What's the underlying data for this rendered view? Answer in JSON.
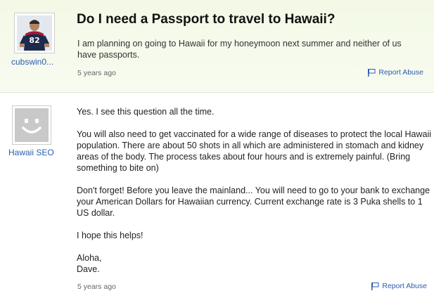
{
  "question": {
    "asker_name": "cubswin0...",
    "title": "Do I need a Passport to travel to Hawaii?",
    "body": "I am planning on going to Hawaii for my honeymoon next summer and neither of us have passports.",
    "time": "5 years ago",
    "report_label": "Report Abuse"
  },
  "answer": {
    "answerer_name": "Hawaii SEO",
    "paragraphs": [
      "Yes. I see this question all the time.",
      "You will also need to get vaccinated for a wide range of diseases to protect the local Hawaii population. There are about 50 shots in all which are administered in stomach and kidney areas of the body. The process takes about four hours and is extremely painful. (Bring something to bite on)",
      "Don't forget! Before you leave the mainland... You will need to go to your bank to exchange your American Dollars for Hawaiian currency. Current exchange rate is 3 Puka shells to 1 US dollar.",
      "I hope this helps!"
    ],
    "signoff_line1": "Aloha,",
    "signoff_line2": "Dave.",
    "time": "5 years ago",
    "report_label": "Report Abuse"
  },
  "colors": {
    "link": "#2a5db0",
    "question_bg": "#f3f9e6"
  },
  "icons": {
    "report": "flag-icon",
    "answerer_avatar": "default-smiley-avatar"
  }
}
